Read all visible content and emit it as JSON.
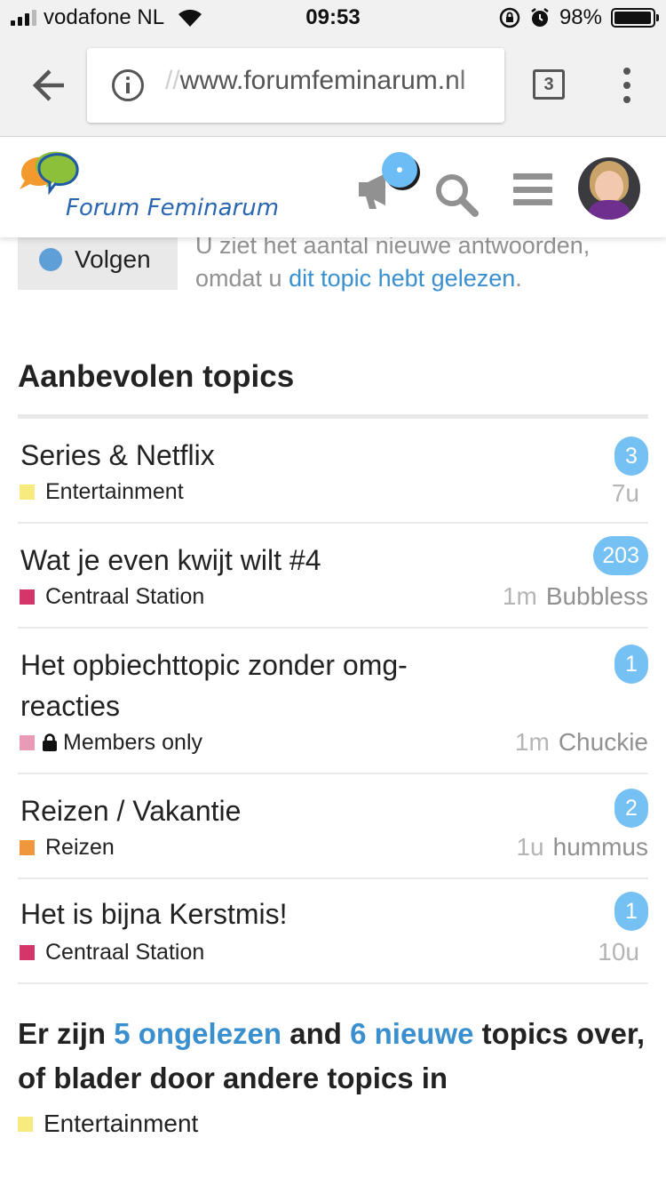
{
  "status_bar": {
    "carrier": "vodafone NL",
    "time": "09:53",
    "battery": "98%",
    "battery_level": 0.98
  },
  "browser": {
    "url_scheme": "//",
    "url_host": "www.forumfeminarum.nl",
    "tab_count": "3"
  },
  "site": {
    "logo_text": "Forum Feminarum"
  },
  "follow": {
    "button_label": "Volgen",
    "description_prefix": "U ziet het aantal nieuwe antwoorden, omdat u ",
    "description_link": "dit topic hebt gelezen",
    "description_suffix": "."
  },
  "suggested": {
    "title": "Aanbevolen topics",
    "topics": [
      {
        "title": "Series & Netflix",
        "category": "Entertainment",
        "category_color": "#f7eb80",
        "locked": false,
        "replies": "3",
        "age": "7u",
        "user": ""
      },
      {
        "title": "Wat je even kwijt wilt #4",
        "category": "Centraal Station",
        "category_color": "#d4366a",
        "locked": false,
        "replies": "203",
        "age": "1m",
        "user": "Bubbless"
      },
      {
        "title": "Het opbiechttopic zonder omg-reacties",
        "category": "Members only",
        "category_color": "#e89ab6",
        "locked": true,
        "replies": "1",
        "age": "1m",
        "user": "Chuckie"
      },
      {
        "title": "Reizen / Vakantie",
        "category": "Reizen",
        "category_color": "#f0963c",
        "locked": false,
        "replies": "2",
        "age": "1u",
        "user": "hummus"
      },
      {
        "title": "Het is bijna Kerstmis!",
        "category": "Centraal Station",
        "category_color": "#d4366a",
        "locked": false,
        "replies": "1",
        "age": "10u",
        "user": ""
      }
    ]
  },
  "more": {
    "prefix": "Er zijn ",
    "unread_link": "5 ongelezen",
    "middle": " and ",
    "new_link": "6 nieuwe",
    "suffix": " topics over, of blader door andere topics in",
    "category": "Entertainment",
    "category_color": "#f7eb80"
  }
}
